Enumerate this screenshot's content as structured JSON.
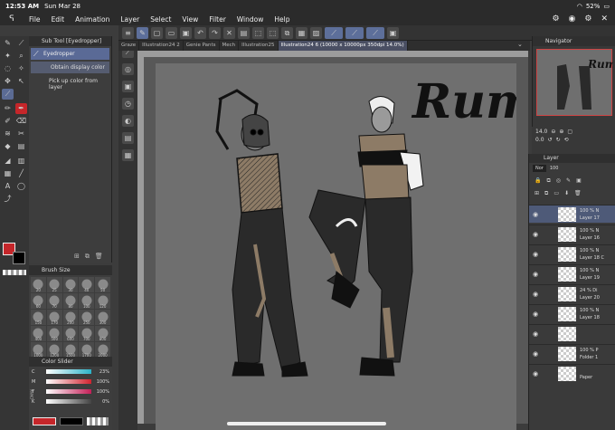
{
  "status": {
    "time": "12:53 AM",
    "date": "Sun Mar 28",
    "battery": "52%"
  },
  "menu": [
    "File",
    "Edit",
    "Animation",
    "Layer",
    "Select",
    "View",
    "Filter",
    "Window",
    "Help"
  ],
  "tabs": [
    {
      "label": "Graze"
    },
    {
      "label": "Illustration24 2"
    },
    {
      "label": "Genie Pants"
    },
    {
      "label": "Mech"
    },
    {
      "label": "Illustration25"
    },
    {
      "label": "Illustration24 6 (10000 x 10000px 350dpi 14.0%)",
      "active": true
    }
  ],
  "subtool": {
    "header": "Sub Tool [Eyedropper]",
    "items": [
      {
        "label": "Eyedropper",
        "active": true
      }
    ],
    "lines": [
      "Obtain display color",
      "Pick up color from layer"
    ]
  },
  "brushsize": {
    "header": "Brush Size",
    "sizes": [
      "20",
      "25",
      "30",
      "40",
      "50",
      "60",
      "70",
      "80",
      "100",
      "120",
      "150",
      "170",
      "200",
      "250",
      "300",
      "400",
      "500",
      "600",
      "700",
      "800",
      "1000",
      "1200",
      "1500",
      "1700",
      "2000"
    ]
  },
  "colorslider": {
    "header": "Color Slider",
    "rows": [
      {
        "label": "C",
        "value": "23%",
        "color": "#2cb3c8"
      },
      {
        "label": "M",
        "value": "100%",
        "color": "#d0232f"
      },
      {
        "label": "Y",
        "value": "100%",
        "color": "#c41f57"
      },
      {
        "label": "K",
        "value": "0%",
        "color": "#444444"
      }
    ],
    "side_label": "CMYK"
  },
  "canvas": {
    "title_text": "Rum",
    "background": "#6f6f6f"
  },
  "navigator": {
    "header": "Navigator",
    "zoom": "14.0",
    "angle": "0.0"
  },
  "layers": {
    "header": "Layer",
    "blend": "Nor",
    "opacity": "100",
    "rows": [
      {
        "pct": "100 % N",
        "name": "Layer 17",
        "selected": true
      },
      {
        "pct": "100 % N",
        "name": "Layer 16"
      },
      {
        "pct": "100 % N",
        "name": "Layer 18 C"
      },
      {
        "pct": "100 % N",
        "name": "Layer 19"
      },
      {
        "pct": "24 % Di",
        "name": "Layer 20"
      },
      {
        "pct": "100 % N",
        "name": "Layer 18"
      },
      {
        "pct": "",
        "name": ""
      },
      {
        "pct": "100 % P",
        "name": "Folder 1"
      },
      {
        "pct": "",
        "name": "Paper"
      }
    ]
  },
  "colors": {
    "main": "#c5262a",
    "sub": "#000000",
    "accent": "#5a6a96"
  }
}
